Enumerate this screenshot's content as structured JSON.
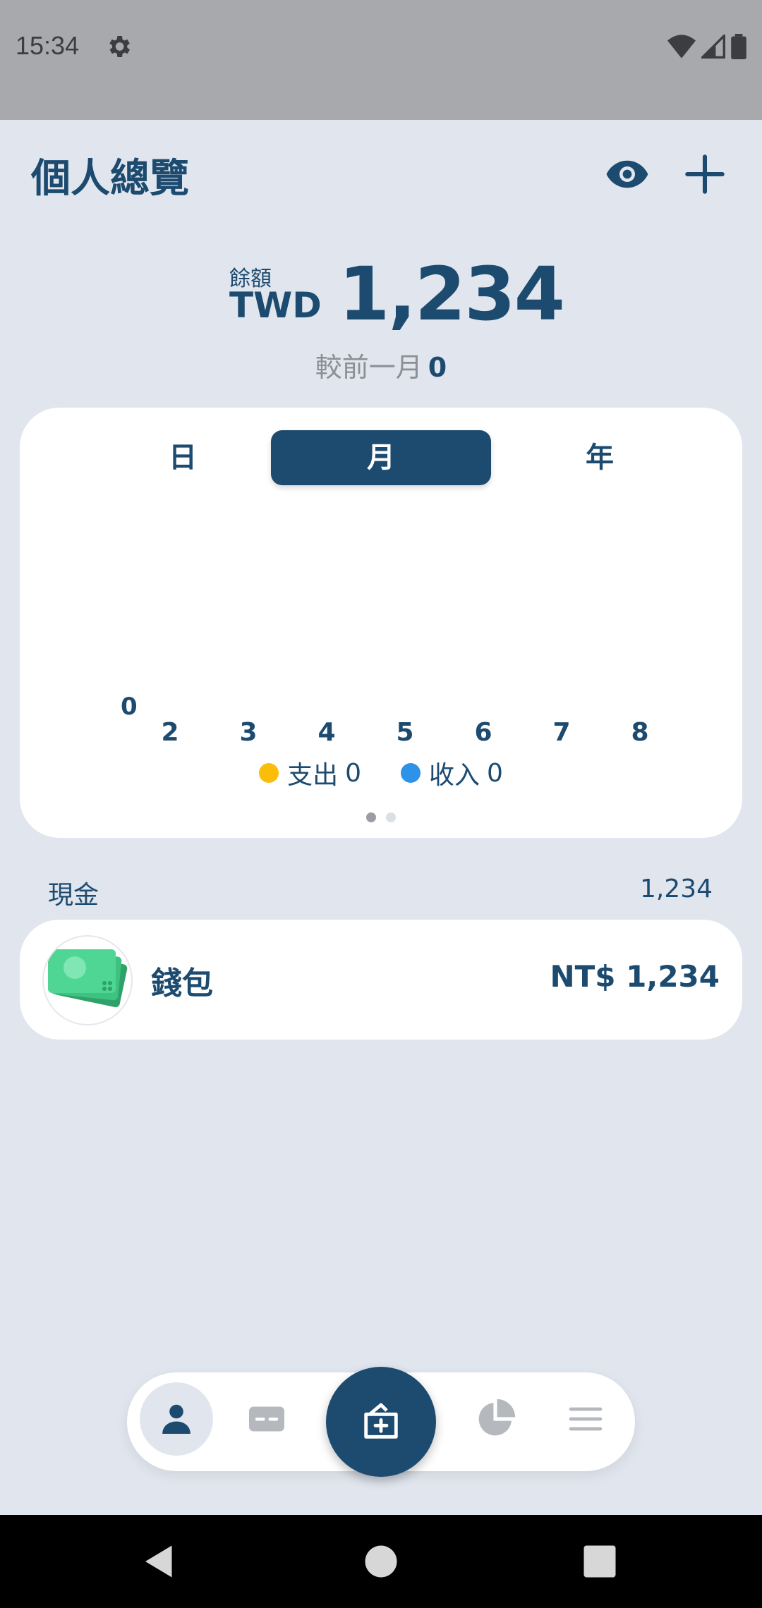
{
  "status_bar": {
    "time": "15:34"
  },
  "header": {
    "title": "個人總覽"
  },
  "balance": {
    "label": "餘額",
    "currency": "TWD",
    "amount": "1,234",
    "compare_label": "較前一月",
    "compare_value": "0"
  },
  "chart_card": {
    "tabs": [
      {
        "label": "日",
        "active": false
      },
      {
        "label": "月",
        "active": true
      },
      {
        "label": "年",
        "active": false
      }
    ]
  },
  "chart_data": {
    "type": "bar",
    "y_value_label": "0",
    "categories": [
      "2",
      "3",
      "4",
      "5",
      "6",
      "7",
      "8"
    ],
    "series": [
      {
        "name": "支出",
        "values": [
          0,
          0,
          0,
          0,
          0,
          0,
          0
        ],
        "total": "0",
        "color": "#fbbd08"
      },
      {
        "name": "收入",
        "values": [
          0,
          0,
          0,
          0,
          0,
          0,
          0
        ],
        "total": "0",
        "color": "#2e93e8"
      }
    ],
    "legend_position": "bottom",
    "page_indicator": {
      "pages": 2,
      "current": 1
    }
  },
  "cash_section": {
    "title": "現金",
    "total": "1,234",
    "accounts": [
      {
        "name": "錢包",
        "balance": "NT$ 1,234",
        "icon": "cash-icon"
      }
    ]
  },
  "bottom_nav": {
    "items": [
      {
        "icon": "person-icon",
        "active": true
      },
      {
        "icon": "card-icon",
        "active": false
      },
      {
        "icon": "add-record-icon",
        "active": false
      },
      {
        "icon": "pie-chart-icon",
        "active": false
      },
      {
        "icon": "menu-icon",
        "active": false
      }
    ]
  },
  "colors": {
    "primary": "#1d4b70",
    "background": "#e1e6ee",
    "expense": "#fbbd08",
    "income": "#2e93e8"
  }
}
